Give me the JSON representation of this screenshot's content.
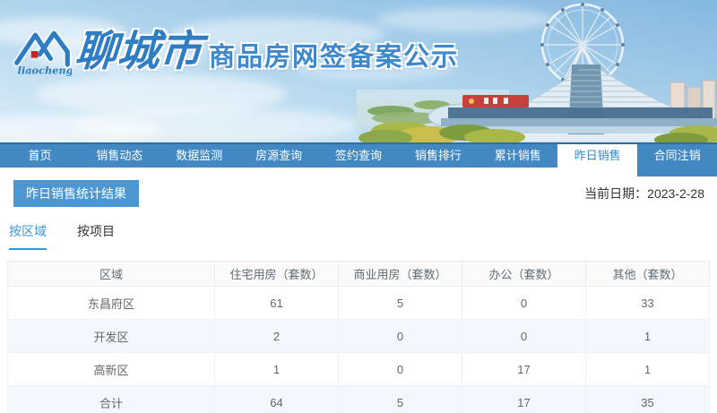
{
  "brand": {
    "logo_text": "liaocheng",
    "title_script": "聊城市",
    "title_main": "商品房网签备案公示"
  },
  "nav": {
    "items": [
      {
        "label": "首页",
        "active": false
      },
      {
        "label": "销售动态",
        "active": false
      },
      {
        "label": "数据监测",
        "active": false
      },
      {
        "label": "房源查询",
        "active": false
      },
      {
        "label": "签约查询",
        "active": false
      },
      {
        "label": "销售排行",
        "active": false
      },
      {
        "label": "累计销售",
        "active": false
      },
      {
        "label": "昨日销售",
        "active": true
      },
      {
        "label": "合同注销",
        "active": false
      }
    ]
  },
  "main": {
    "section_title": "昨日销售统计结果",
    "date_label": "当前日期：",
    "date_value": "2023-2-28",
    "view_tabs": [
      {
        "label": "按区域",
        "active": true
      },
      {
        "label": "按项目",
        "active": false
      }
    ]
  },
  "table": {
    "columns": [
      "区域",
      "住宅用房（套数）",
      "商业用房（套数）",
      "办公（套数）",
      "其他（套数）"
    ],
    "rows": [
      {
        "region": "东昌府区",
        "values": [
          "61",
          "5",
          "0",
          "33"
        ]
      },
      {
        "region": "开发区",
        "values": [
          "2",
          "0",
          "0",
          "1"
        ]
      },
      {
        "region": "高新区",
        "values": [
          "1",
          "0",
          "17",
          "1"
        ]
      },
      {
        "region": "合计",
        "values": [
          "64",
          "5",
          "17",
          "35"
        ]
      }
    ]
  },
  "colors": {
    "nav_blue": "#4288c2",
    "accent_blue": "#3d96d4",
    "badge_blue": "#4b98d3",
    "alt_row_blue": "#f2f8fd",
    "title_blue": "#3e88cb"
  }
}
